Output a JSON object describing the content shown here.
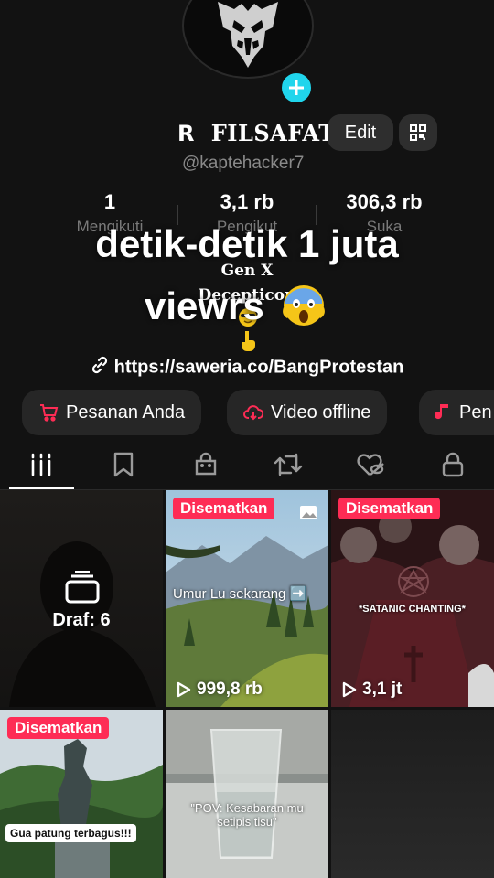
{
  "profile": {
    "name": "FILSAFAT",
    "name_prefix": "R",
    "handle": "@kaptehacker7",
    "edit_label": "Edit"
  },
  "stats": [
    {
      "value": "1",
      "label": "Mengikuti"
    },
    {
      "value": "3,1 rb",
      "label": "Pengikut"
    },
    {
      "value": "306,3 rb",
      "label": "Suka"
    }
  ],
  "overlay": {
    "line1": "detik-detik 1 juta",
    "line2": "viewrs"
  },
  "bio": {
    "line1": "Gen X",
    "line2": "Decepticon"
  },
  "link": "https://saweria.co/BangProtestan",
  "chips": [
    {
      "label": "Pesanan Anda",
      "icon": "cart-icon"
    },
    {
      "label": "Video offline",
      "icon": "cloud-download-icon"
    },
    {
      "label": "Pen",
      "icon": "music-note-icon"
    }
  ],
  "tabs": [
    {
      "icon": "videos-grid-icon",
      "active": true
    },
    {
      "icon": "bookmark-icon"
    },
    {
      "icon": "shop-bag-icon"
    },
    {
      "icon": "repost-icon"
    },
    {
      "icon": "liked-hidden-icon"
    },
    {
      "icon": "lock-icon"
    }
  ],
  "grid": {
    "draft_label": "Draf: 6",
    "pinned_label": "Disematkan",
    "videos": [
      {
        "caption": "Umur Lu sekarang ➡️",
        "views": "999,8 rb",
        "pinned": true
      },
      {
        "caption": "*SATANIC CHANTING*",
        "views": "3,1 jt",
        "pinned": true
      },
      {
        "caption": "Gua patung terbagus!!!",
        "views": "",
        "pinned": true
      },
      {
        "caption": "\"POV: Kesabaran mu setipis tisu\"",
        "views": "",
        "pinned": false
      }
    ]
  },
  "colors": {
    "background": "#121212",
    "accent_pink": "#fe2c55",
    "accent_cyan": "#20d5ec",
    "chip_bg": "#262626"
  }
}
